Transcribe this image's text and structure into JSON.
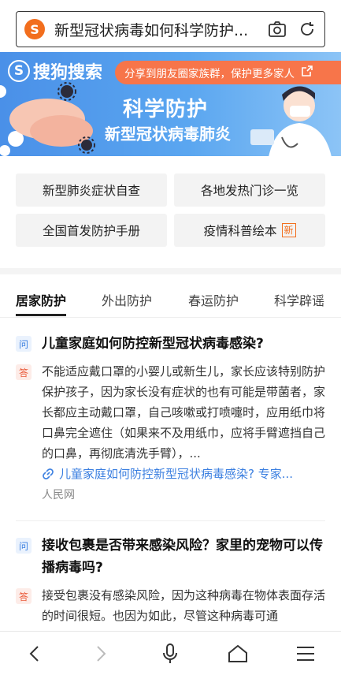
{
  "search": {
    "logo_letter": "S",
    "query": "新型冠状病毒如何科学防护..."
  },
  "banner": {
    "brand_letter": "S",
    "brand": "搜狗搜索",
    "share_text": "分享到朋友圈家族群，保护更多家人",
    "title": "科学防护",
    "subtitle": "新型冠状病毒肺炎"
  },
  "quick_links": [
    {
      "label": "新型肺炎症状自查"
    },
    {
      "label": "各地发热门诊一览"
    },
    {
      "label": "全国首发防护手册"
    },
    {
      "label": "疫情科普绘本",
      "badge": "新"
    }
  ],
  "tabs": [
    {
      "label": "居家防护"
    },
    {
      "label": "外出防护"
    },
    {
      "label": "春运防护"
    },
    {
      "label": "科学辟谣"
    }
  ],
  "qa_items": [
    {
      "q_tag": "问",
      "question": "儿童家庭如何防控新型冠状病毒感染?",
      "a_tag": "答",
      "answer": "不能适应戴口罩的小婴儿或新生儿，家长应该特别防护保护孩子，因为家长没有症状的也有可能是带菌者，家长都应主动戴口罩，自己咳嗽或打喷嚏时，应用纸巾将口鼻完全遮住（如果来不及用纸巾，应将手臂遮挡自己的口鼻，再彻底清洗手臂），...",
      "link": "儿童家庭如何防控新型冠状病毒感染? 专家...",
      "source": "人民网"
    },
    {
      "q_tag": "问",
      "question": "接收包裹是否带来感染风险？家里的宠物可以传播病毒吗?",
      "a_tag": "答",
      "answer": "接受包裹没有感染风险，因为这种病毒在物体表面存活的时间很短。也因为如此，尽管这种病毒可通"
    }
  ],
  "colors": {
    "accent_orange": "#f26e1d",
    "banner_blue": "#4a90e8",
    "link_blue": "#3b7fe0"
  }
}
